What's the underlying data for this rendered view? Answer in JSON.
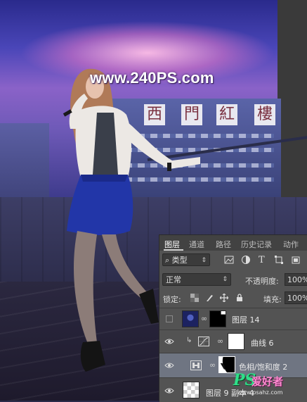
{
  "photo": {
    "watermark": "www.240PS.com",
    "sign_chars": [
      "西",
      "門",
      "紅",
      "樓"
    ]
  },
  "layers_panel": {
    "tabs": [
      "图层",
      "通道",
      "路径",
      "历史记录",
      "动作"
    ],
    "active_tab": "图层",
    "filter_kind": "类型",
    "blend_mode": "正常",
    "opacity_label": "不透明度:",
    "opacity_value": "100%",
    "lock_label": "锁定:",
    "fill_label": "填充:",
    "fill_value": "100%",
    "layers": [
      {
        "name": "图层 14",
        "visible": false,
        "type": "image-with-mask"
      },
      {
        "name": "曲线 6",
        "visible": true,
        "type": "curves-adjustment",
        "clipped": true
      },
      {
        "name": "色相/饱和度 2",
        "visible": true,
        "type": "hue-saturation-adjustment",
        "selected": true
      },
      {
        "name": "图层 9 副本 4",
        "visible": true,
        "type": "image"
      }
    ]
  },
  "logo": {
    "ps": "PS",
    "cn": "爱好者",
    "url": "www.psahz.com"
  }
}
